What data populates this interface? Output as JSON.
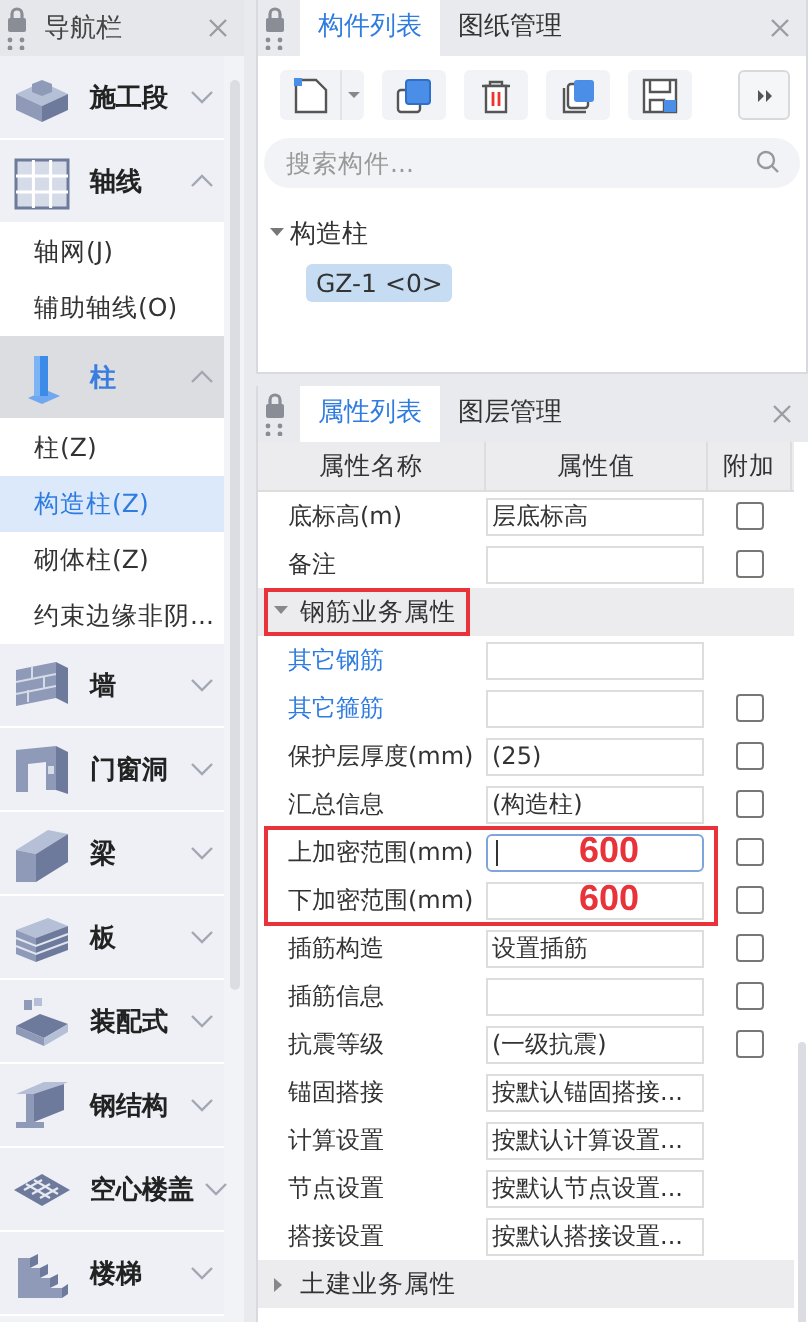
{
  "navigator": {
    "title": "导航栏",
    "groups": [
      {
        "label": "施工段",
        "expanded": false,
        "selected": false
      },
      {
        "label": "轴线",
        "expanded": true,
        "selected": false,
        "items": [
          {
            "label": "轴网(J)",
            "selected": false
          },
          {
            "label": "辅助轴线(O)",
            "selected": false
          }
        ]
      },
      {
        "label": "柱",
        "expanded": true,
        "selected": true,
        "items": [
          {
            "label": "柱(Z)",
            "selected": false
          },
          {
            "label": "构造柱(Z)",
            "selected": true
          },
          {
            "label": "砌体柱(Z)",
            "selected": false
          },
          {
            "label": "约束边缘非阴...",
            "selected": false
          }
        ]
      },
      {
        "label": "墙",
        "expanded": false,
        "selected": false
      },
      {
        "label": "门窗洞",
        "expanded": false,
        "selected": false
      },
      {
        "label": "梁",
        "expanded": false,
        "selected": false
      },
      {
        "label": "板",
        "expanded": false,
        "selected": false
      },
      {
        "label": "装配式",
        "expanded": false,
        "selected": false
      },
      {
        "label": "钢结构",
        "expanded": false,
        "selected": false
      },
      {
        "label": "空心楼盖",
        "expanded": false,
        "selected": false
      },
      {
        "label": "楼梯",
        "expanded": false,
        "selected": false
      }
    ]
  },
  "component_panel": {
    "tabs": [
      {
        "label": "构件列表",
        "selected": true
      },
      {
        "label": "图纸管理",
        "selected": false
      }
    ],
    "search": {
      "placeholder": "搜索构件..."
    },
    "tree": [
      {
        "label": "构造柱",
        "expanded": true,
        "children": [
          {
            "label": "GZ-1 <0>",
            "selected": true
          }
        ]
      }
    ]
  },
  "property_panel": {
    "tabs": [
      {
        "label": "属性列表",
        "selected": true
      },
      {
        "label": "图层管理",
        "selected": false
      }
    ],
    "columns": [
      "属性名称",
      "属性值",
      "附加"
    ],
    "rows": [
      {
        "kind": "prop",
        "name": "底标高(m)",
        "value": "层底标高",
        "checked": false
      },
      {
        "kind": "prop",
        "name": "备注",
        "checked": false
      },
      {
        "kind": "group",
        "name": "钢筋业务属性",
        "expanded": true,
        "highlight": true
      },
      {
        "kind": "link",
        "name": "其它钢筋"
      },
      {
        "kind": "link",
        "name": "其它箍筋",
        "checked": false
      },
      {
        "kind": "prop",
        "name": "保护层厚度(mm)",
        "value": "(25)",
        "checked": false
      },
      {
        "kind": "prop",
        "name": "汇总信息",
        "value": "(构造柱)",
        "checked": false
      },
      {
        "kind": "prop",
        "name": "上加密范围(mm)",
        "focused": true,
        "annotation": "600",
        "highlight": true,
        "checked": false
      },
      {
        "kind": "prop",
        "name": "下加密范围(mm)",
        "focused": false,
        "annotation": "600",
        "highlight": true,
        "checked": false
      },
      {
        "kind": "prop",
        "name": "插筋构造",
        "value": "设置插筋",
        "checked": false
      },
      {
        "kind": "prop",
        "name": "插筋信息",
        "checked": false
      },
      {
        "kind": "prop",
        "name": "抗震等级",
        "value": "(一级抗震)",
        "checked": false
      },
      {
        "kind": "prop",
        "name": "锚固搭接",
        "value": "按默认锚固搭接..."
      },
      {
        "kind": "prop",
        "name": "计算设置",
        "value": "按默认计算设置..."
      },
      {
        "kind": "prop",
        "name": "节点设置",
        "value": "按默认节点设置..."
      },
      {
        "kind": "prop",
        "name": "搭接设置",
        "value": "按默认搭接设置..."
      },
      {
        "kind": "group",
        "name": "土建业务属性",
        "expanded": false
      }
    ]
  }
}
